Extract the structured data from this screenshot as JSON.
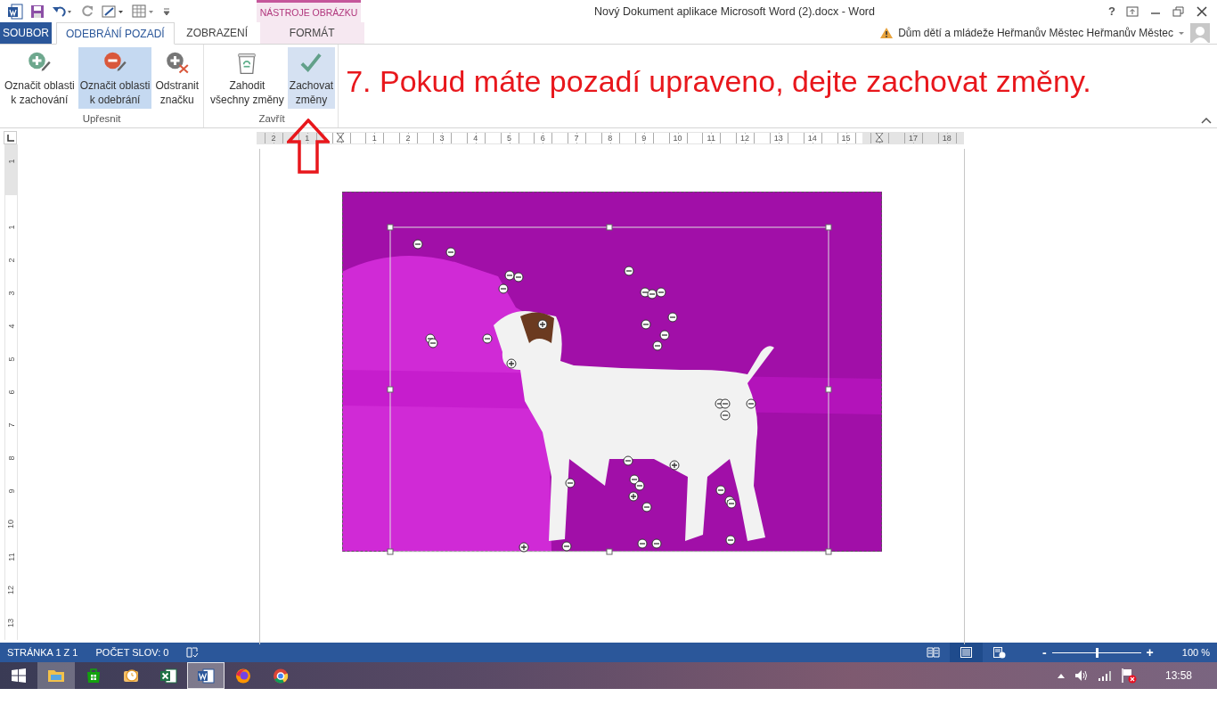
{
  "window": {
    "title": "Nový Dokument aplikace Microsoft Word (2).docx - Word",
    "contextual_group": "NÁSTROJE OBRÁZKU",
    "help": "?"
  },
  "tabs": [
    {
      "label": "SOUBOR",
      "kind": "file",
      "selected": false
    },
    {
      "label": "ODEBRÁNÍ POZADÍ",
      "kind": "tab",
      "selected": true
    },
    {
      "label": "ZOBRAZENÍ",
      "kind": "tab",
      "selected": false
    },
    {
      "label": "FORMÁT",
      "kind": "contextual",
      "selected": false
    }
  ],
  "account": {
    "name": "Dům dětí a mládeže Heřmanův Městec Heřmanův Městec"
  },
  "ribbon_groups": [
    {
      "label": "Upřesnit",
      "buttons": [
        {
          "label": "Označit oblasti\nk zachování",
          "kind": "mark-keep",
          "selected": false,
          "hovered": false
        },
        {
          "label": "Označit oblasti\nk odebrání",
          "kind": "mark-remove",
          "selected": true,
          "hovered": false
        },
        {
          "label": "Odstranit\nznačku",
          "kind": "delete-mark",
          "selected": false,
          "hovered": false
        }
      ]
    },
    {
      "label": "Zavřít",
      "buttons": [
        {
          "label": "Zahodit\nvšechny změny",
          "kind": "discard",
          "selected": false,
          "hovered": false
        },
        {
          "label": "Zachovat\nzměny",
          "kind": "keep",
          "selected": false,
          "hovered": true
        }
      ]
    }
  ],
  "annotation": {
    "text": "7. Pokud máte pozadí upraveno, dejte zachovat změny."
  },
  "ruler": {
    "horizontal": [
      {
        "kind": "number",
        "label": "2"
      },
      {
        "kind": "number",
        "label": "1"
      },
      {
        "kind": "indent"
      },
      {
        "kind": "number",
        "label": "1"
      },
      {
        "kind": "number",
        "label": "2"
      },
      {
        "kind": "number",
        "label": "3"
      },
      {
        "kind": "number",
        "label": "4"
      },
      {
        "kind": "number",
        "label": "5"
      },
      {
        "kind": "number",
        "label": "6"
      },
      {
        "kind": "number",
        "label": "7"
      },
      {
        "kind": "number",
        "label": "8"
      },
      {
        "kind": "number",
        "label": "9"
      },
      {
        "kind": "number",
        "label": "10"
      },
      {
        "kind": "number",
        "label": "11"
      },
      {
        "kind": "number",
        "label": "12"
      },
      {
        "kind": "number",
        "label": "13"
      },
      {
        "kind": "number",
        "label": "14"
      },
      {
        "kind": "number",
        "label": "15"
      },
      {
        "kind": "indent"
      },
      {
        "kind": "number",
        "label": "17"
      },
      {
        "kind": "number",
        "label": "18"
      }
    ],
    "vertical": [
      {
        "kind": "number",
        "label": "1"
      },
      {
        "kind": "indent"
      },
      {
        "kind": "number",
        "label": "1"
      },
      {
        "kind": "number",
        "label": "2"
      },
      {
        "kind": "number",
        "label": "3"
      },
      {
        "kind": "number",
        "label": "4"
      },
      {
        "kind": "number",
        "label": "5"
      },
      {
        "kind": "number",
        "label": "6"
      },
      {
        "kind": "number",
        "label": "7"
      },
      {
        "kind": "number",
        "label": "8"
      },
      {
        "kind": "number",
        "label": "9"
      },
      {
        "kind": "number",
        "label": "10"
      },
      {
        "kind": "number",
        "label": "11"
      },
      {
        "kind": "number",
        "label": "12"
      },
      {
        "kind": "number",
        "label": "13"
      }
    ]
  },
  "status_bar": {
    "page": "STRÁNKA 1 Z 1",
    "words": "POČET SLOV: 0",
    "views": [
      {
        "kind": "read",
        "selected": false
      },
      {
        "kind": "print",
        "selected": true
      },
      {
        "kind": "web",
        "selected": false
      }
    ],
    "zoom": {
      "minus": "-",
      "plus": "+",
      "level": 0.5,
      "reading": "100 %"
    }
  },
  "taskbar": {
    "apps": [
      {
        "kind": "explorer",
        "open": true,
        "selected": false
      },
      {
        "kind": "store",
        "open": false,
        "selected": false
      },
      {
        "kind": "outlook",
        "open": false,
        "selected": false
      },
      {
        "kind": "excel",
        "open": false,
        "selected": false
      },
      {
        "kind": "word",
        "open": true,
        "selected": true
      },
      {
        "kind": "firefox",
        "open": false,
        "selected": false
      },
      {
        "kind": "chrome",
        "open": false,
        "selected": false
      }
    ],
    "clock": "13:58"
  }
}
